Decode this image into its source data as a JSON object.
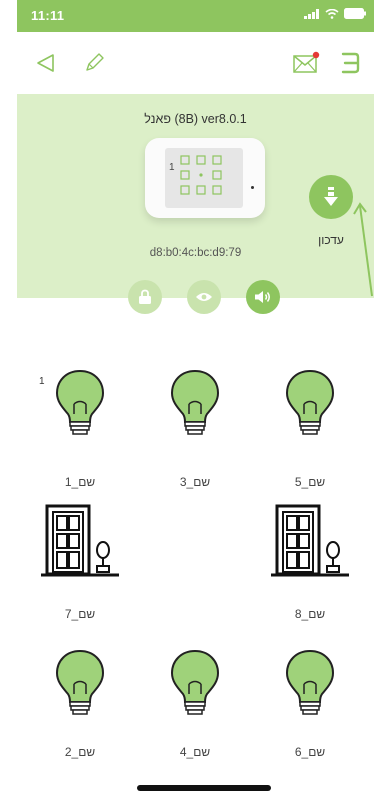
{
  "status_bar": {
    "time": "11:11"
  },
  "nav": {
    "back_icon": "back-triangle-icon",
    "edit_icon": "pencil-icon",
    "mail_icon": "mail-icon",
    "menu_icon": "menu-icon"
  },
  "panel": {
    "title": "פאנל (8B) ver8.0.1",
    "mac": "d8:b0:4c:bc:d9:79",
    "device_label": "1",
    "update_label": "עדכון"
  },
  "controls": [
    {
      "name": "lock-icon",
      "active": false
    },
    {
      "name": "eye-icon",
      "active": false
    },
    {
      "name": "speaker-icon",
      "active": true
    }
  ],
  "devices": [
    {
      "label": "שם_1",
      "type": "bulb",
      "badge": "1"
    },
    {
      "label": "שם_3",
      "type": "bulb",
      "badge": ""
    },
    {
      "label": "שם_5",
      "type": "bulb",
      "badge": ""
    },
    {
      "label": "שם_7",
      "type": "door",
      "badge": ""
    },
    {
      "label": "",
      "type": "empty",
      "badge": ""
    },
    {
      "label": "שם_8",
      "type": "door",
      "badge": ""
    },
    {
      "label": "שם_2",
      "type": "bulb",
      "badge": ""
    },
    {
      "label": "שם_4",
      "type": "bulb",
      "badge": ""
    },
    {
      "label": "שם_6",
      "type": "bulb",
      "badge": ""
    }
  ],
  "colors": {
    "accent": "#8ec55f",
    "panel_bg": "#dcefc8",
    "status_bg": "#8ec55f"
  }
}
